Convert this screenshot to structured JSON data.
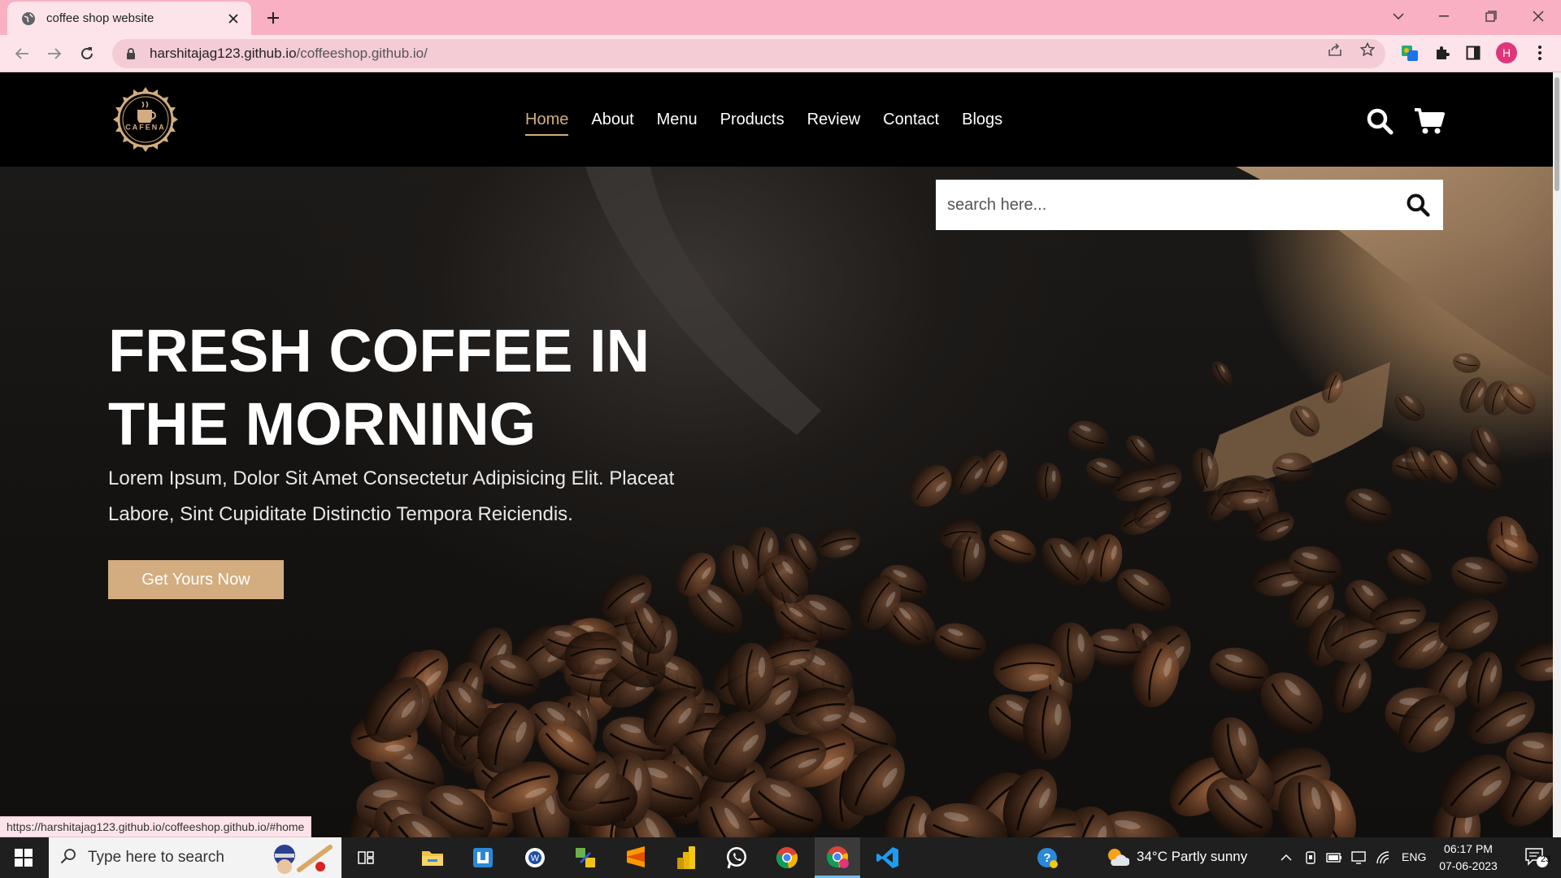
{
  "browser": {
    "tab_title": "coffee shop website",
    "url_host": "harshitajag123.github.io",
    "url_path": "/coffeeshop.github.io/",
    "profile_initial": "H",
    "status_url": "https://harshitajag123.github.io/coffeeshop.github.io/#home"
  },
  "site": {
    "logo_text": "CAFENA",
    "nav": [
      "Home",
      "About",
      "Menu",
      "Products",
      "Review",
      "Contact",
      "Blogs"
    ],
    "active_nav": "Home",
    "search_placeholder": "search here...",
    "hero_title": "FRESH COFFEE IN THE MORNING",
    "hero_text": "Lorem Ipsum, Dolor Sit Amet Consectetur Adipisicing Elit. Placeat Labore, Sint Cupiditate Distinctio Tempora Reiciendis.",
    "hero_button": "Get Yours Now",
    "accent_color": "#d3ad7f"
  },
  "taskbar": {
    "search_placeholder": "Type here to search",
    "weather": "34°C  Partly sunny",
    "language": "ENG",
    "time": "06:17 PM",
    "date": "07-06-2023",
    "notifications": "23"
  }
}
